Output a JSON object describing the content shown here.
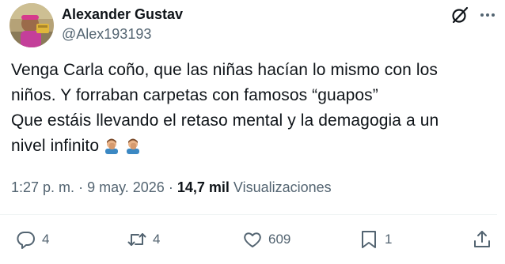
{
  "author": {
    "name": "Alexander Gustav",
    "handle": "@Alex193193"
  },
  "header_icons": [
    "grok-icon",
    "more-options-icon"
  ],
  "body": {
    "lines": [
      "Venga Carla coño, que las niñas hacían lo mismo con los",
      "niños. Y forraban carpetas con famosos “guapos”",
      "Que estáis llevando el retaso mental y la demagogia a un",
      "nivel infinito"
    ],
    "emojis": [
      "man-facepalming-emoji",
      "man-facepalming-emoji"
    ]
  },
  "meta": {
    "time": "1:27 p. m.",
    "separator": "·",
    "date": "9 may. 2026",
    "views_count": "14,7 mil",
    "views_label": "Visualizaciones"
  },
  "actions": {
    "replies": "4",
    "reposts": "4",
    "likes": "609",
    "bookmarks": "1"
  },
  "colors": {
    "text_primary": "#0f1419",
    "text_secondary": "#536471",
    "divider": "#eff3f4"
  }
}
